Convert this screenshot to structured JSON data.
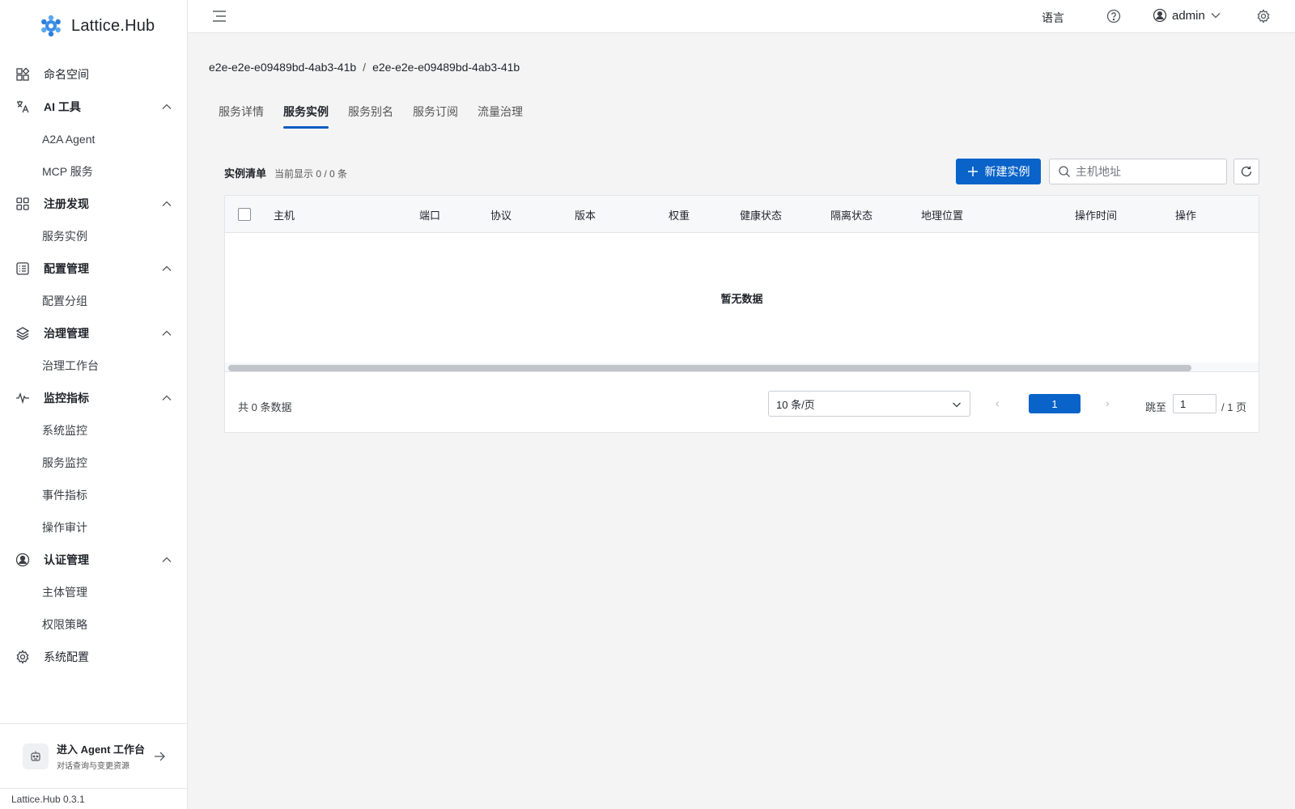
{
  "app": {
    "name": "Lattice.Hub",
    "version": "Lattice.Hub 0.3.1"
  },
  "sidebar": {
    "items": [
      {
        "type": "group",
        "label": "命名空间",
        "icon": "namespace-icon",
        "bold": false,
        "expanded": null
      },
      {
        "type": "group",
        "label": "AI 工具",
        "icon": "translate-icon",
        "bold": true,
        "expanded": true
      },
      {
        "type": "sub",
        "label": "A2A Agent"
      },
      {
        "type": "sub",
        "label": "MCP 服务"
      },
      {
        "type": "group",
        "label": "注册发现",
        "icon": "grid-icon",
        "bold": true,
        "expanded": true
      },
      {
        "type": "sub",
        "label": "服务实例"
      },
      {
        "type": "group",
        "label": "配置管理",
        "icon": "list-icon",
        "bold": true,
        "expanded": true
      },
      {
        "type": "sub",
        "label": "配置分组"
      },
      {
        "type": "group",
        "label": "治理管理",
        "icon": "layers-icon",
        "bold": true,
        "expanded": true
      },
      {
        "type": "sub",
        "label": "治理工作台"
      },
      {
        "type": "group",
        "label": "监控指标",
        "icon": "activity-icon",
        "bold": true,
        "expanded": true
      },
      {
        "type": "sub",
        "label": "系统监控"
      },
      {
        "type": "sub",
        "label": "服务监控"
      },
      {
        "type": "sub",
        "label": "事件指标"
      },
      {
        "type": "sub",
        "label": "操作审计"
      },
      {
        "type": "group",
        "label": "认证管理",
        "icon": "user-circle-icon",
        "bold": true,
        "expanded": true
      },
      {
        "type": "sub",
        "label": "主体管理"
      },
      {
        "type": "sub",
        "label": "权限策略"
      },
      {
        "type": "group",
        "label": "系统配置",
        "icon": "gear-icon",
        "bold": false,
        "expanded": null
      }
    ],
    "agent": {
      "title": "进入 Agent 工作台",
      "subtitle": "对话查询与变更资源"
    }
  },
  "topbar": {
    "language": "语言",
    "user": "admin"
  },
  "breadcrumb": [
    "e2e-e2e-e09489bd-4ab3-41b",
    "e2e-e2e-e09489bd-4ab3-41b"
  ],
  "breadcrumb_separator": "/",
  "tabs": [
    {
      "label": "服务详情",
      "active": false
    },
    {
      "label": "服务实例",
      "active": true
    },
    {
      "label": "服务别名",
      "active": false
    },
    {
      "label": "服务订阅",
      "active": false
    },
    {
      "label": "流量治理",
      "active": false
    }
  ],
  "list": {
    "title": "实例清单",
    "count": "当前显示 0 / 0 条",
    "new_button": "新建实例",
    "search_placeholder": "主机地址"
  },
  "table": {
    "columns": [
      "主机",
      "端口",
      "协议",
      "版本",
      "权重",
      "健康状态",
      "隔离状态",
      "地理位置",
      "操作时间",
      "操作"
    ],
    "rows": [],
    "empty_text": "暂无数据"
  },
  "pagination": {
    "total": "共 0 条数据",
    "page_size": "10 条/页",
    "current_page": "1",
    "jump_label": "跳至",
    "jump_value": "1",
    "total_pages": "/ 1 页"
  },
  "colors": {
    "accent": "#0a63c9",
    "background": "#f4f4f4"
  }
}
